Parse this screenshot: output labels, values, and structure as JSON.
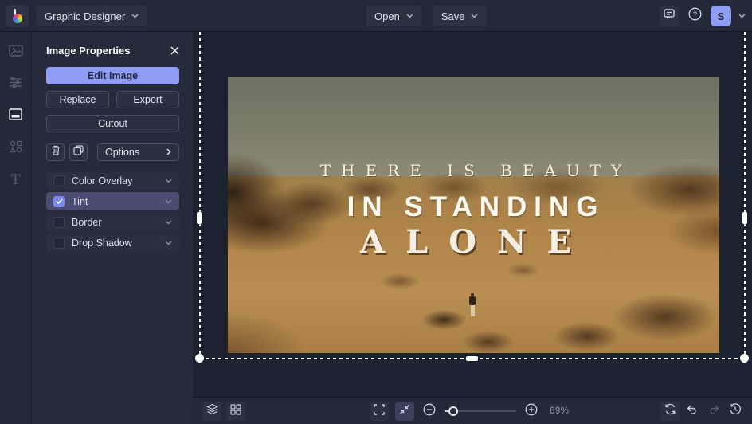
{
  "topbar": {
    "mode_label": "Graphic Designer",
    "open_label": "Open",
    "save_label": "Save",
    "avatar_initial": "S"
  },
  "sidebar": {
    "tools": [
      "image",
      "adjustments",
      "layout",
      "graphics",
      "text"
    ],
    "active_tool": "layout"
  },
  "panel": {
    "title": "Image Properties",
    "edit_image_label": "Edit Image",
    "replace_label": "Replace",
    "export_label": "Export",
    "cutout_label": "Cutout",
    "options_label": "Options",
    "properties": [
      {
        "label": "Color Overlay",
        "checked": false,
        "active": false
      },
      {
        "label": "Tint",
        "checked": true,
        "active": true
      },
      {
        "label": "Border",
        "checked": false,
        "active": false
      },
      {
        "label": "Drop Shadow",
        "checked": false,
        "active": false
      }
    ]
  },
  "canvas": {
    "image_text_lines": [
      "THERE IS BEAUTY",
      "IN STANDING",
      "ALONE"
    ]
  },
  "toolbar": {
    "zoom_value": "69%"
  },
  "colors": {
    "accent": "#8f9cf3",
    "surface": "#242938",
    "canvas_background": "#1d2231",
    "tint_row_highlight": "#4c4b72"
  }
}
